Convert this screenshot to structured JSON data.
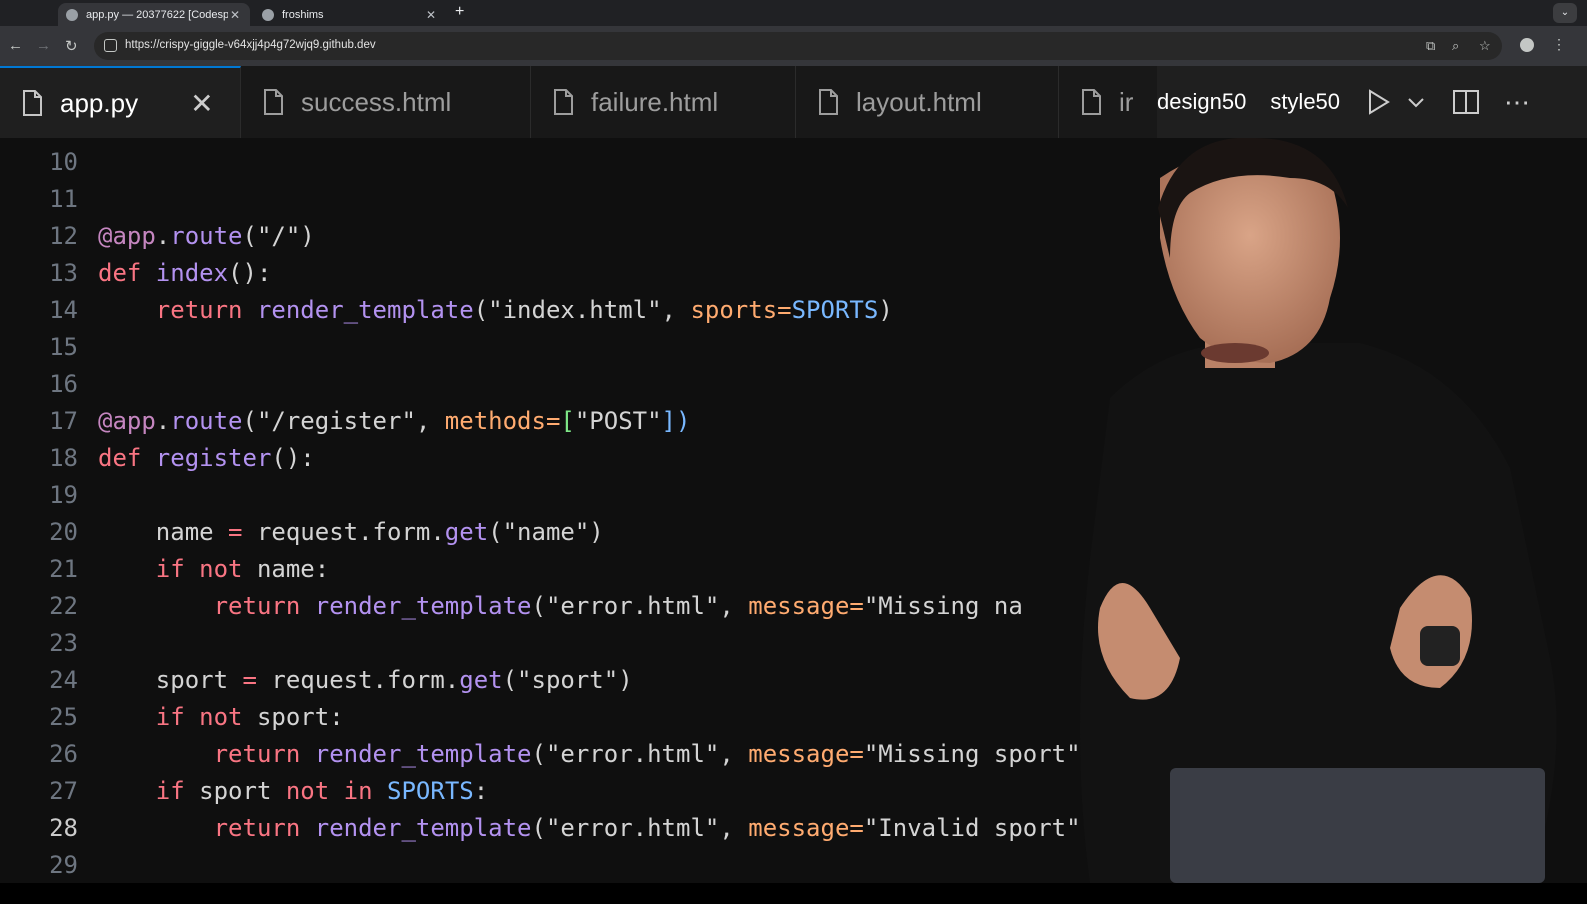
{
  "browser": {
    "tabs": [
      {
        "title": "app.py — 20377622 [Codesp",
        "active": true
      },
      {
        "title": "froshims",
        "active": false
      }
    ],
    "new_tab_label": "+",
    "url": "https://crispy-giggle-v64xjj4p4g72wjq9.github.dev",
    "icons": [
      "back-icon",
      "forward-icon",
      "reload-icon",
      "site-settings-icon",
      "install-icon",
      "zoom-icon",
      "star-icon",
      "profile-icon",
      "menu-icon"
    ]
  },
  "editor": {
    "tabs": [
      {
        "label": "app.py",
        "active": true
      },
      {
        "label": "success.html",
        "active": false
      },
      {
        "label": "failure.html",
        "active": false
      },
      {
        "label": "layout.html",
        "active": false
      },
      {
        "label": "ir",
        "active": false
      }
    ],
    "actions": {
      "design": "design50",
      "style": "style50"
    },
    "current_line": 28,
    "lines": [
      {
        "num": "10",
        "tokens": []
      },
      {
        "num": "11",
        "tokens": []
      },
      {
        "num": "12",
        "tokens": [
          {
            "t": "@app",
            "c": "#c586c0"
          },
          {
            "t": ".",
            "c": "#d4d4d4"
          },
          {
            "t": "route",
            "c": "#b392f0"
          },
          {
            "t": "(\"/\")",
            "c": "#d4d4d4"
          }
        ]
      },
      {
        "num": "13",
        "tokens": [
          {
            "t": "def ",
            "c": "#f97583"
          },
          {
            "t": "index",
            "c": "#b392f0"
          },
          {
            "t": "():",
            "c": "#d4d4d4"
          }
        ]
      },
      {
        "num": "14",
        "tokens": [
          {
            "t": "    ",
            "c": "#d4d4d4"
          },
          {
            "t": "return ",
            "c": "#f97583"
          },
          {
            "t": "render_template",
            "c": "#b392f0"
          },
          {
            "t": "(\"index.html\", ",
            "c": "#d4d4d4"
          },
          {
            "t": "sports=",
            "c": "#ffab70"
          },
          {
            "t": "SPORTS",
            "c": "#79b8ff"
          },
          {
            "t": ")",
            "c": "#d4d4d4"
          }
        ]
      },
      {
        "num": "15",
        "tokens": []
      },
      {
        "num": "16",
        "tokens": []
      },
      {
        "num": "17",
        "tokens": [
          {
            "t": "@app",
            "c": "#c586c0"
          },
          {
            "t": ".",
            "c": "#d4d4d4"
          },
          {
            "t": "route",
            "c": "#b392f0"
          },
          {
            "t": "(\"/register\", ",
            "c": "#d4d4d4"
          },
          {
            "t": "methods=",
            "c": "#ffab70"
          },
          {
            "t": "[",
            "c": "#7ee787"
          },
          {
            "t": "\"POST\"",
            "c": "#d4d4d4"
          },
          {
            "t": "])",
            "c": "#79b8ff"
          }
        ]
      },
      {
        "num": "18",
        "tokens": [
          {
            "t": "def ",
            "c": "#f97583"
          },
          {
            "t": "register",
            "c": "#b392f0"
          },
          {
            "t": "():",
            "c": "#d4d4d4"
          }
        ]
      },
      {
        "num": "19",
        "tokens": []
      },
      {
        "num": "20",
        "tokens": [
          {
            "t": "    name ",
            "c": "#d4d4d4"
          },
          {
            "t": "= ",
            "c": "#f97583"
          },
          {
            "t": "request.form.",
            "c": "#d4d4d4"
          },
          {
            "t": "get",
            "c": "#b392f0"
          },
          {
            "t": "(\"name\")",
            "c": "#d4d4d4"
          }
        ]
      },
      {
        "num": "21",
        "tokens": [
          {
            "t": "    ",
            "c": "#d4d4d4"
          },
          {
            "t": "if not ",
            "c": "#f97583"
          },
          {
            "t": "name:",
            "c": "#d4d4d4"
          }
        ]
      },
      {
        "num": "22",
        "tokens": [
          {
            "t": "        ",
            "c": "#d4d4d4"
          },
          {
            "t": "return ",
            "c": "#f97583"
          },
          {
            "t": "render_template",
            "c": "#b392f0"
          },
          {
            "t": "(\"error.html\", ",
            "c": "#d4d4d4"
          },
          {
            "t": "message=",
            "c": "#ffab70"
          },
          {
            "t": "\"Missing na",
            "c": "#d4d4d4"
          }
        ]
      },
      {
        "num": "23",
        "tokens": []
      },
      {
        "num": "24",
        "tokens": [
          {
            "t": "    sport ",
            "c": "#d4d4d4"
          },
          {
            "t": "= ",
            "c": "#f97583"
          },
          {
            "t": "request.form.",
            "c": "#d4d4d4"
          },
          {
            "t": "get",
            "c": "#b392f0"
          },
          {
            "t": "(\"sport\")",
            "c": "#d4d4d4"
          }
        ]
      },
      {
        "num": "25",
        "tokens": [
          {
            "t": "    ",
            "c": "#d4d4d4"
          },
          {
            "t": "if not ",
            "c": "#f97583"
          },
          {
            "t": "sport:",
            "c": "#d4d4d4"
          }
        ]
      },
      {
        "num": "26",
        "tokens": [
          {
            "t": "        ",
            "c": "#d4d4d4"
          },
          {
            "t": "return ",
            "c": "#f97583"
          },
          {
            "t": "render_template",
            "c": "#b392f0"
          },
          {
            "t": "(\"error.html\", ",
            "c": "#d4d4d4"
          },
          {
            "t": "message=",
            "c": "#ffab70"
          },
          {
            "t": "\"Missing sport\"",
            "c": "#d4d4d4"
          }
        ]
      },
      {
        "num": "27",
        "tokens": [
          {
            "t": "    ",
            "c": "#d4d4d4"
          },
          {
            "t": "if ",
            "c": "#f97583"
          },
          {
            "t": "sport ",
            "c": "#d4d4d4"
          },
          {
            "t": "not in ",
            "c": "#f97583"
          },
          {
            "t": "SPORTS",
            "c": "#79b8ff"
          },
          {
            "t": ":",
            "c": "#d4d4d4"
          }
        ]
      },
      {
        "num": "28",
        "tokens": [
          {
            "t": "        ",
            "c": "#d4d4d4"
          },
          {
            "t": "return ",
            "c": "#f97583"
          },
          {
            "t": "render_template",
            "c": "#b392f0"
          },
          {
            "t": "(\"error.html\", ",
            "c": "#d4d4d4"
          },
          {
            "t": "message=",
            "c": "#ffab70"
          },
          {
            "t": "\"Invalid sport\"",
            "c": "#d4d4d4"
          }
        ]
      },
      {
        "num": "29",
        "tokens": []
      }
    ]
  },
  "colors": {
    "accent": "#0078d4",
    "editor_bg": "#0f0f0f",
    "chrome_bg": "#202124"
  }
}
